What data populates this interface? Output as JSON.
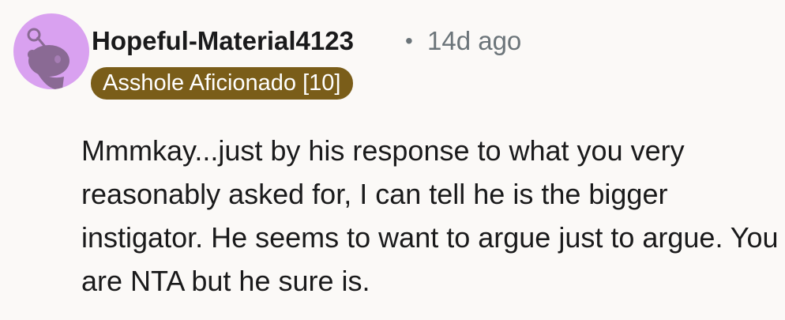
{
  "comment": {
    "author": "Hopeful-Material4123",
    "separator": "•",
    "timestamp": "14d ago",
    "flair": "Asshole Aficionado [10]",
    "body": "Mmmkay...just by his response to what you very reasonably asked for, I can tell he is the bigger instigator. He seems to want to argue just to argue. You are NTA but he sure is."
  },
  "avatar": {
    "icon": "snoo-avatar-icon",
    "background_color": "#d9a1f0",
    "figure_color": "#8a6a94"
  },
  "colors": {
    "background": "#fbf9f7",
    "text": "#1a1a1b",
    "meta": "#6b7479",
    "flair_background": "#7a5d19",
    "flair_text": "#ffffff"
  }
}
